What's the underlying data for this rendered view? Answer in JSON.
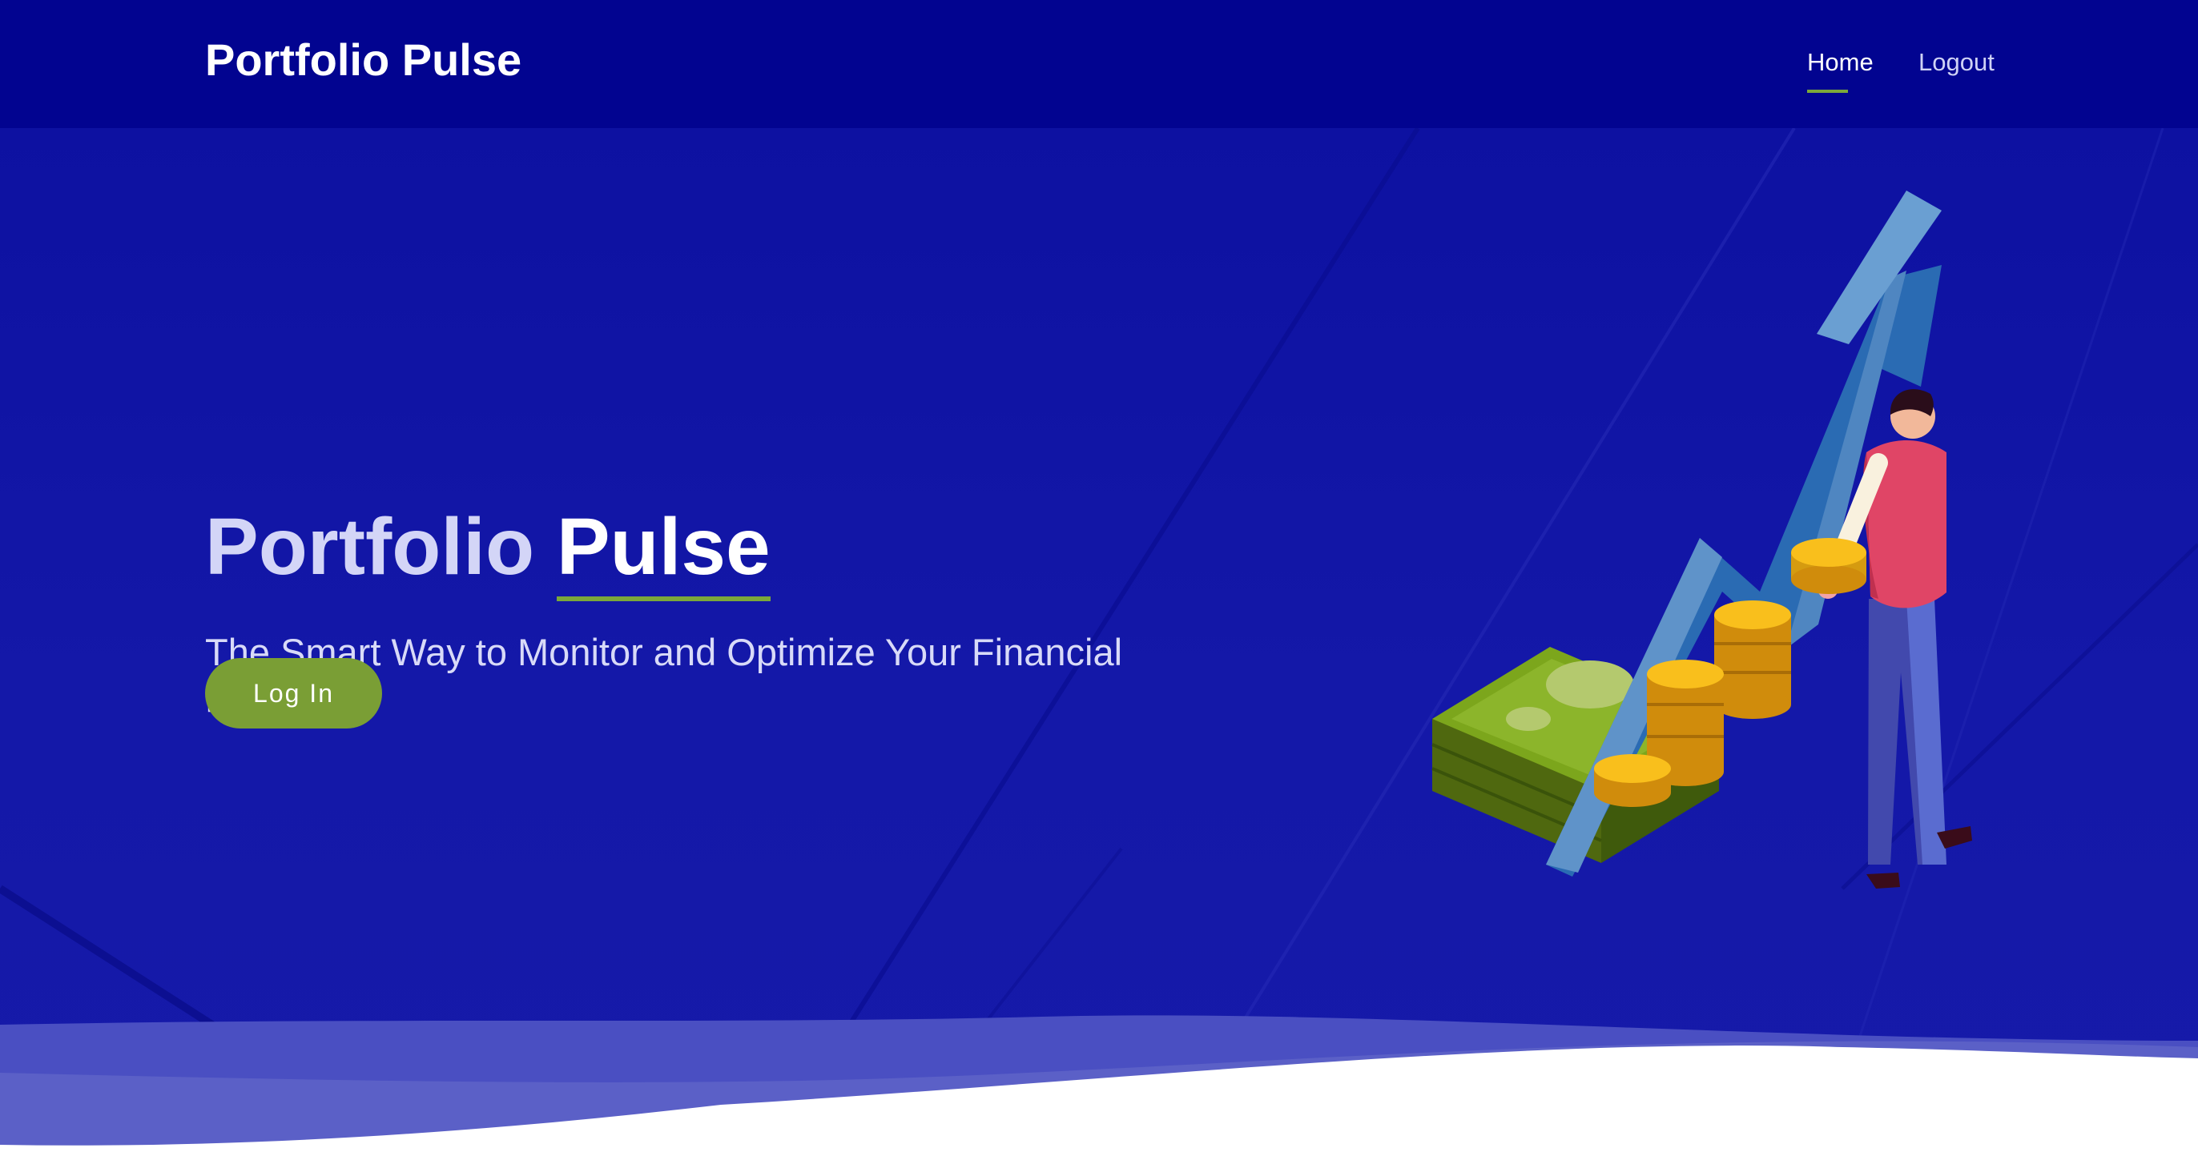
{
  "header": {
    "brand": "Portfolio Pulse",
    "nav": [
      {
        "label": "Home",
        "active": true
      },
      {
        "label": "Logout",
        "active": false
      }
    ]
  },
  "hero": {
    "title_part1": "Portfolio",
    "title_part2": "Pulse",
    "subtitle": "The Smart Way to Monitor and Optimize Your Financial Future",
    "cta_label": "Log In"
  },
  "illustration": {
    "subject": "person placing coin beside cash stack, coin stacks and rising arrow"
  },
  "colors": {
    "nav_background": "#020490",
    "hero_background": "#1418a8",
    "accent_green": "#7ba83a",
    "button_green": "#7a9e35",
    "arrow_blue": "#2a6bb3",
    "coin_gold": "#f7b917",
    "shirt_red": "#e04566"
  }
}
